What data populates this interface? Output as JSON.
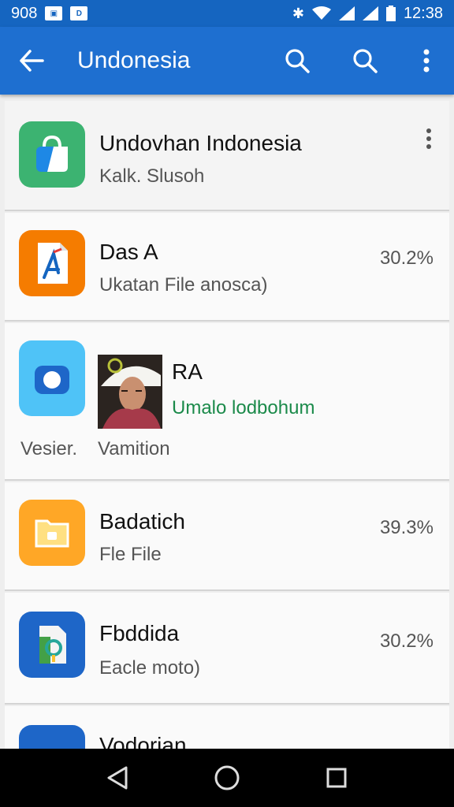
{
  "status_bar": {
    "left_text": "908",
    "time": "12:38",
    "left_box_label": "D"
  },
  "app_bar": {
    "title": "Undonesia",
    "back_icon": "arrow-left-icon",
    "search_icon": "search-icon",
    "more_icon": "more-vert-icon"
  },
  "items": [
    {
      "title": "Undovhan Indonesia",
      "subtitle": "Kalk. Slusoh",
      "icon": "bag-icon",
      "icon_color": "#3cb371"
    },
    {
      "title": "Das A",
      "subtitle": "Ukatan File anosca)",
      "percent": "30.2%",
      "icon": "document-icon",
      "icon_color": "#f57c00"
    },
    {
      "title": "RA",
      "subtitle": "Umalo lodbohum",
      "footer_left": "Vesier.",
      "footer_right": "Vamition",
      "icon": "camera-icon",
      "icon_color": "#4fc3f7"
    },
    {
      "title": "Badatich",
      "subtitle": "Fle File",
      "percent": "39.3%",
      "icon": "folder-icon",
      "icon_color": "#ffa726"
    },
    {
      "title": "Fbddida",
      "subtitle": "Eacle moto)",
      "percent": "30.2%",
      "icon": "maps-icon",
      "icon_color": "#1e66c8"
    },
    {
      "title": "Vodorian",
      "icon": "app-icon",
      "icon_color": "#1e66c8"
    }
  ],
  "nav_bar": {
    "back": "triangle-back-icon",
    "home": "circle-home-icon",
    "recents": "square-recents-icon"
  }
}
